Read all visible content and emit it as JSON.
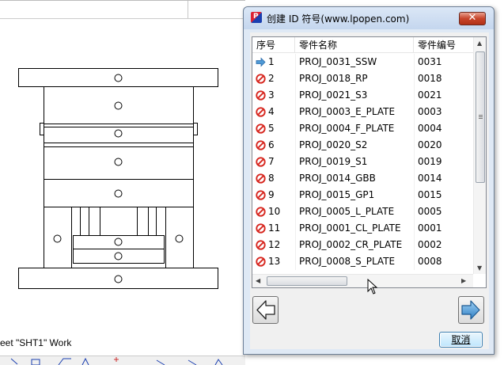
{
  "cad": {
    "status_text": "eet \"SHT1\" Work"
  },
  "dialog": {
    "title": "创建 ID 符号(www.lpopen.com)",
    "app_icon_letter": "P",
    "close_glyph": "✕",
    "columns": [
      "序号",
      "零件名称",
      "零件编号"
    ],
    "rows": [
      {
        "icon": "arrow-right-icon",
        "seq": "1",
        "name": "PROJ_0031_SSW",
        "code": "0031"
      },
      {
        "icon": "prohibited-icon",
        "seq": "2",
        "name": "PROJ_0018_RP",
        "code": "0018"
      },
      {
        "icon": "prohibited-icon",
        "seq": "3",
        "name": "PROJ_0021_S3",
        "code": "0021"
      },
      {
        "icon": "prohibited-icon",
        "seq": "4",
        "name": "PROJ_0003_E_PLATE",
        "code": "0003"
      },
      {
        "icon": "prohibited-icon",
        "seq": "5",
        "name": "PROJ_0004_F_PLATE",
        "code": "0004"
      },
      {
        "icon": "prohibited-icon",
        "seq": "6",
        "name": "PROJ_0020_S2",
        "code": "0020"
      },
      {
        "icon": "prohibited-icon",
        "seq": "7",
        "name": "PROJ_0019_S1",
        "code": "0019"
      },
      {
        "icon": "prohibited-icon",
        "seq": "8",
        "name": "PROJ_0014_GBB",
        "code": "0014"
      },
      {
        "icon": "prohibited-icon",
        "seq": "9",
        "name": "PROJ_0015_GP1",
        "code": "0015"
      },
      {
        "icon": "prohibited-icon",
        "seq": "10",
        "name": "PROJ_0005_L_PLATE",
        "code": "0005"
      },
      {
        "icon": "prohibited-icon",
        "seq": "11",
        "name": "PROJ_0001_CL_PLATE",
        "code": "0001"
      },
      {
        "icon": "prohibited-icon",
        "seq": "12",
        "name": "PROJ_0002_CR_PLATE",
        "code": "0002"
      },
      {
        "icon": "prohibited-icon",
        "seq": "13",
        "name": "PROJ_0008_S_PLATE",
        "code": "0008"
      }
    ],
    "prev_button_icon": "arrow-left-outline-icon",
    "next_button_icon": "arrow-right-blue-icon",
    "cancel_label": "取消",
    "colors": {
      "title_bar": "#c4d6ee",
      "close_button": "#c7442a",
      "prohibited": "#d7261e",
      "arrow": "#4f9ad6"
    }
  }
}
